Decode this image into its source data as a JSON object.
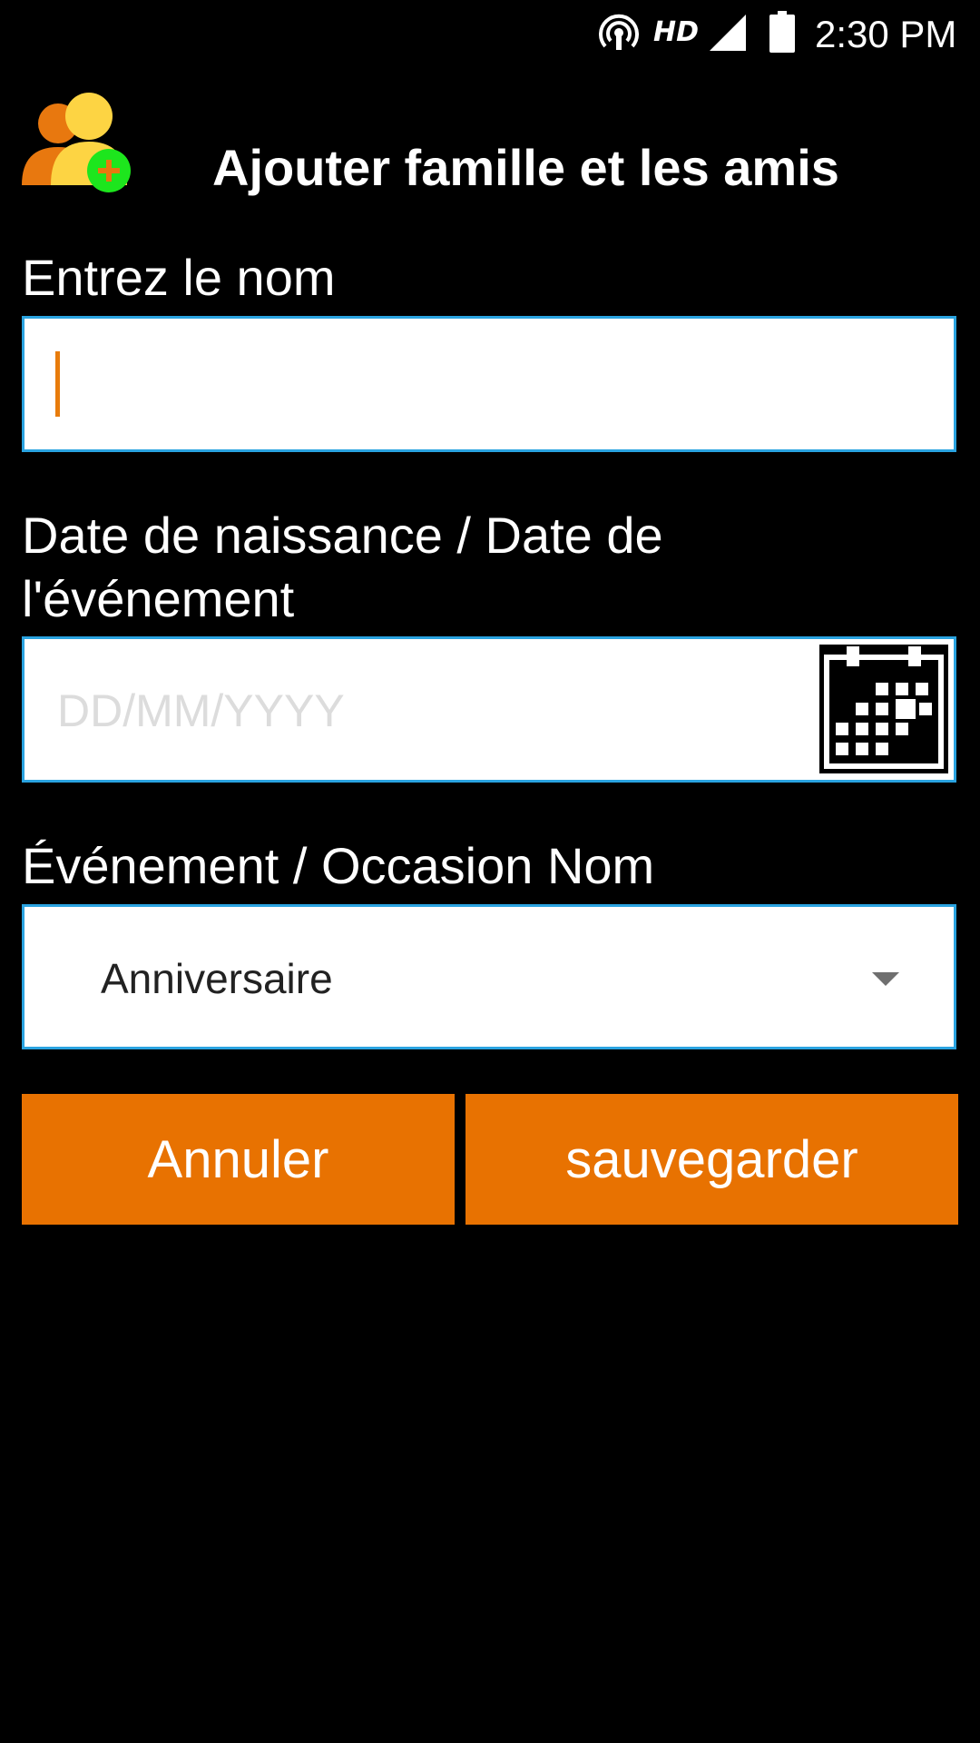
{
  "status_bar": {
    "icons": [
      "hotspot-icon",
      "signal-icon",
      "battery-icon"
    ],
    "hd_label": "HD",
    "time": "2:30 PM"
  },
  "header": {
    "logo_icon": "add-contacts-icon",
    "title": "Ajouter famille et les amis"
  },
  "form": {
    "name_label": "Entrez le nom",
    "name_value": "",
    "date_label": "Date de naissance / Date de l'événement",
    "date_placeholder": "DD/MM/YYYY",
    "calendar_icon": "calendar-icon",
    "event_label": "Événement / Occasion Nom",
    "event_selected": "Anniversaire"
  },
  "actions": {
    "cancel_label": "Annuler",
    "save_label": "sauvegarder"
  },
  "colors": {
    "background": "#000000",
    "accent": "#e87201",
    "input_border": "#2aa3e0",
    "logo_orange": "#e8780f",
    "logo_yellow": "#fdd443",
    "logo_plus_green": "#1de61d"
  }
}
